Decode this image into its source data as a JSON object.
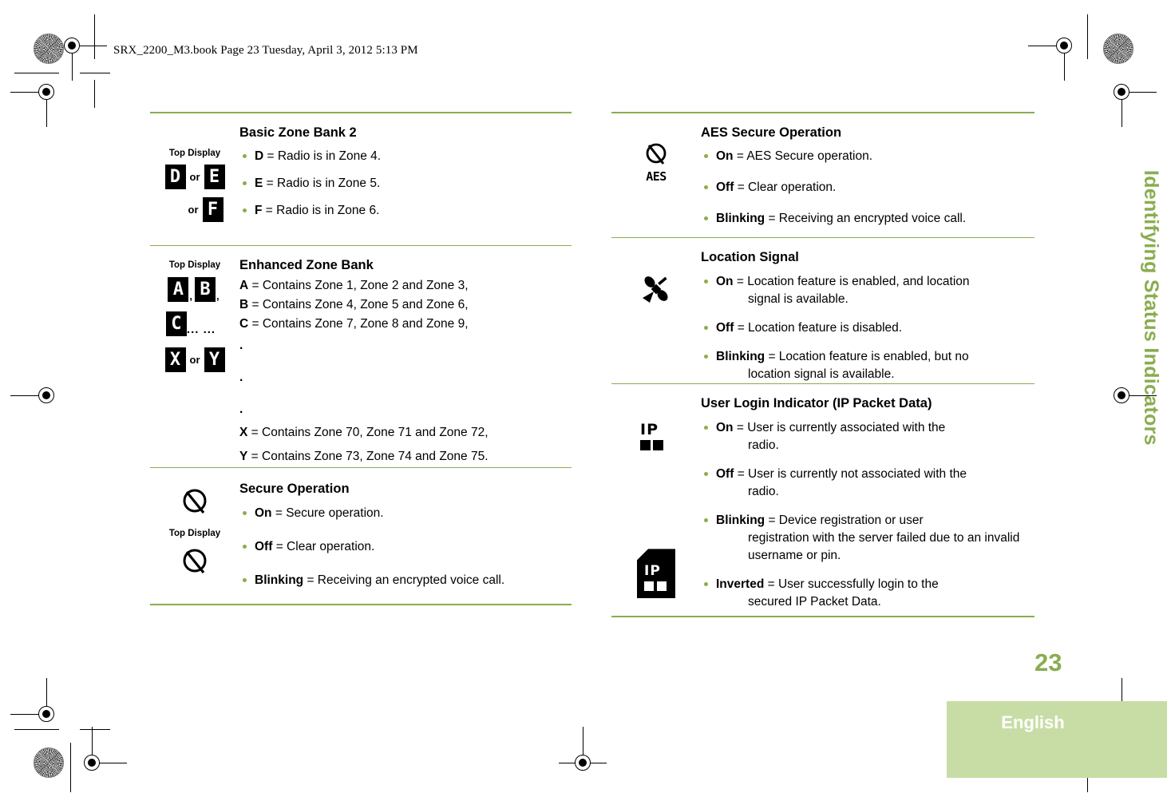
{
  "header": {
    "book_line": "SRX_2200_M3.book  Page 23  Tuesday, April 3, 2012  5:13 PM"
  },
  "side_tab": {
    "title": "Identifying Status Indicators"
  },
  "footer": {
    "page_number": "23",
    "language": "English"
  },
  "colors": {
    "accent_green": "#8aad50",
    "tab_green": "#c8dda5",
    "rule_green": "#8aad50",
    "text_black": "#000000"
  },
  "labels": {
    "top_display": "Top Display",
    "or": "or",
    "comma": ",",
    "ellipsis": "... ..."
  },
  "left_column": {
    "sections": [
      {
        "id": "basic-zone-bank-2",
        "title": "Basic Zone Bank 2",
        "icon_label": "Top Display",
        "icons": [
          "D",
          "E",
          "F"
        ],
        "bullets": [
          {
            "term": "D",
            "desc": " = Radio is in Zone 4."
          },
          {
            "term": "E",
            "desc": " = Radio is in Zone 5."
          },
          {
            "term": "F",
            "desc": " = Radio is in Zone 6."
          }
        ]
      },
      {
        "id": "enhanced-zone-bank",
        "title": "Enhanced Zone Bank",
        "icon_label": "Top Display",
        "icons": [
          "A",
          "B",
          "C",
          "X",
          "Y"
        ],
        "lines": [
          {
            "term": "A",
            "desc": " = Contains Zone 1, Zone 2 and Zone 3,"
          },
          {
            "term": "B",
            "desc": " = Contains Zone 4, Zone 5 and Zone 6,"
          },
          {
            "term": "C",
            "desc": " = Contains Zone 7, Zone 8 and Zone 9,"
          },
          {
            "term": ".",
            "desc": ""
          },
          {
            "term": ".",
            "desc": ""
          },
          {
            "term": ".",
            "desc": ""
          },
          {
            "term": "X",
            "desc": " = Contains Zone 70, Zone 71 and Zone 72,"
          },
          {
            "term": "Y",
            "desc": " = Contains Zone 73, Zone 74 and Zone 75."
          }
        ]
      },
      {
        "id": "secure-operation",
        "title": "Secure Operation",
        "icon_label": "Top Display",
        "icons": [
          "secure-slashed-circle-icon",
          "secure-slashed-circle-icon"
        ],
        "bullets": [
          {
            "term": "On",
            "desc": " = Secure operation."
          },
          {
            "term": "Off",
            "desc": " = Clear operation."
          },
          {
            "term": "Blinking",
            "desc": " = Receiving an encrypted voice call."
          }
        ]
      }
    ]
  },
  "right_column": {
    "sections": [
      {
        "id": "aes-secure-operation",
        "title": "AES Secure Operation",
        "icon": "aes-secure-icon",
        "icon_text": "AES",
        "bullets": [
          {
            "term": "On",
            "desc": " = AES Secure operation.",
            "wrap": ""
          },
          {
            "term": "Off",
            "desc": " = Clear operation.",
            "wrap": ""
          },
          {
            "term": "Blinking",
            "desc": " = Receiving an encrypted voice call.",
            "wrap": ""
          }
        ]
      },
      {
        "id": "location-signal",
        "title": "Location Signal",
        "icon": "satellite-icon",
        "bullets": [
          {
            "term": "On",
            "desc": " = Location feature is enabled, and location",
            "wrap": "signal is available."
          },
          {
            "term": "Off",
            "desc": " = Location feature is disabled.",
            "wrap": ""
          },
          {
            "term": "Blinking",
            "desc": " = Location feature is enabled, but no",
            "wrap": "location signal is available."
          }
        ]
      },
      {
        "id": "user-login-indicator",
        "title": "User Login Indicator (IP Packet Data)",
        "icon": "ip-packet-icon",
        "icon_inverted": "ip-packet-inverted-icon",
        "icon_text": "IP",
        "bullets": [
          {
            "term": "On",
            "desc": " = User is currently associated with the",
            "wrap": "radio."
          },
          {
            "term": "Off",
            "desc": " = User is currently not associated with the",
            "wrap": "radio."
          },
          {
            "term": "Blinking",
            "desc": " = Device registration or user",
            "wrap": "registration with the server failed due to an invalid username or pin."
          },
          {
            "term": "Inverted",
            "desc": " = User successfully login to the",
            "wrap": "secured IP Packet Data."
          }
        ]
      }
    ]
  }
}
